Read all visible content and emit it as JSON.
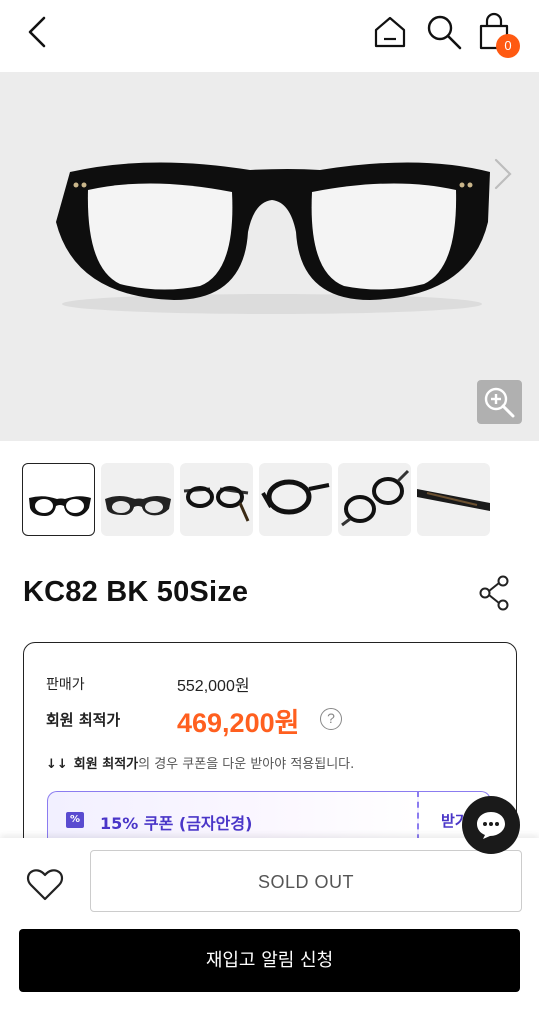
{
  "header": {
    "cart_count": "0",
    "icons": [
      "back-icon",
      "home-icon",
      "search-icon",
      "cart-icon"
    ]
  },
  "product": {
    "title": "KC82 BK 50Size"
  },
  "price": {
    "sale_label": "판매가",
    "sale_value": "552,000원",
    "best_label": "회원 최적가",
    "best_value": "469,200원",
    "help": "?",
    "note_arrow": "↓↓",
    "note_bold": "회원 최적가",
    "note_rest": "의 경우 쿠폰을 다운 받아야 적용됩니다.",
    "accent_color": "#ff5f1f"
  },
  "coupon": {
    "icon_text": "%",
    "label": "15% 쿠폰 (금자안경)",
    "get_label": "받기",
    "accent_color": "#4a36c8"
  },
  "footer": {
    "soldout_label": "SOLD OUT",
    "restock_label": "재입고 알림 신청"
  }
}
